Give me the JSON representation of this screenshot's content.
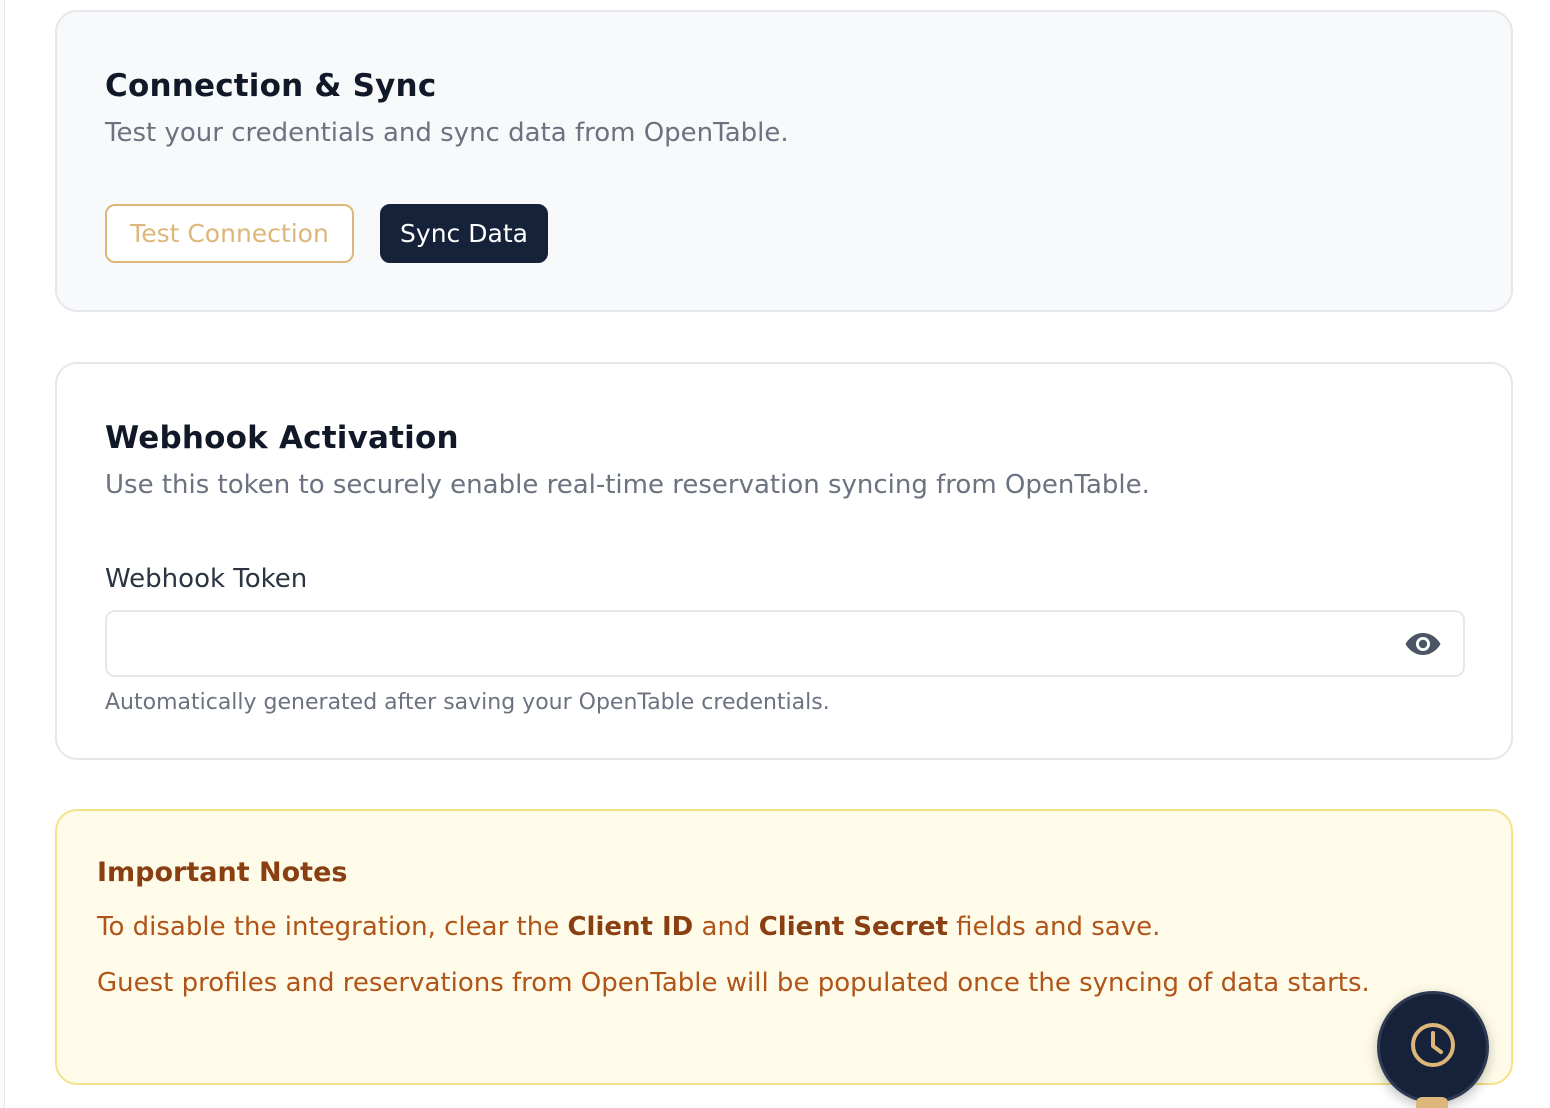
{
  "connection": {
    "title": "Connection & Sync",
    "description": "Test your credentials and sync data from OpenTable.",
    "test_button": "Test Connection",
    "sync_button": "Sync Data"
  },
  "webhook": {
    "title": "Webhook Activation",
    "description": "Use this token to securely enable real-time reservation syncing from OpenTable.",
    "token_label": "Webhook Token",
    "token_value": "",
    "helper": "Automatically generated after saving your OpenTable credentials."
  },
  "notes": {
    "title": "Important Notes",
    "line1": {
      "prefix": "To disable the integration, clear the ",
      "bold1": "Client ID",
      "middle": " and ",
      "bold2": "Client Secret",
      "suffix": " fields and save."
    },
    "line2": "Guest profiles and reservations from OpenTable will be populated once the syncing of data starts."
  },
  "icons": {
    "eye": "eye-icon",
    "clock": "clock-icon"
  },
  "colors": {
    "accent_gold": "#dcb779",
    "navy": "#16213a",
    "note_text": "#b1541a",
    "note_bg": "#fefbe8"
  }
}
